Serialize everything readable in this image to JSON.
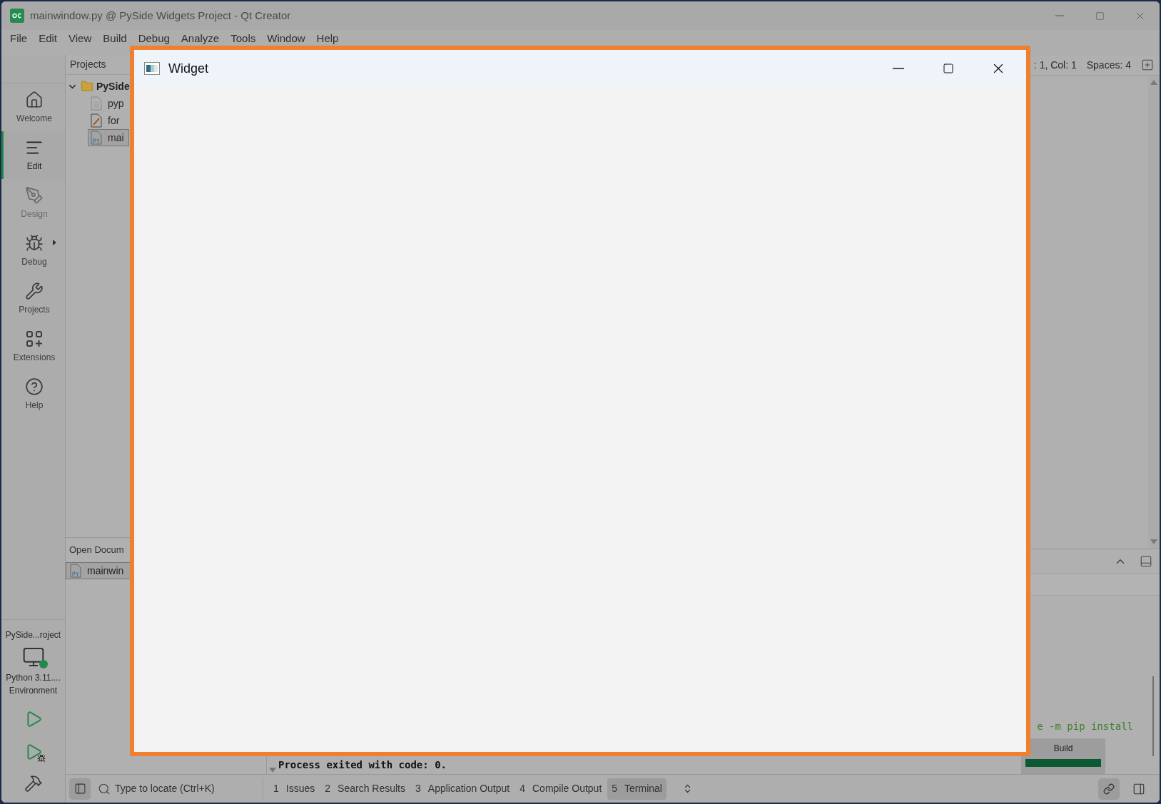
{
  "window": {
    "title": "mainwindow.py @ PySide Widgets Project - Qt Creator"
  },
  "menu": [
    "File",
    "Edit",
    "View",
    "Build",
    "Debug",
    "Analyze",
    "Tools",
    "Window",
    "Help"
  ],
  "modes": [
    {
      "label": "Welcome",
      "selected": false,
      "disabled": false,
      "submenu": false
    },
    {
      "label": "Edit",
      "selected": true,
      "disabled": false,
      "submenu": false
    },
    {
      "label": "Design",
      "selected": false,
      "disabled": true,
      "submenu": false
    },
    {
      "label": "Debug",
      "selected": false,
      "disabled": false,
      "submenu": true
    },
    {
      "label": "Projects",
      "selected": false,
      "disabled": false,
      "submenu": false
    },
    {
      "label": "Extensions",
      "selected": false,
      "disabled": false,
      "submenu": false
    },
    {
      "label": "Help",
      "selected": false,
      "disabled": false,
      "submenu": false
    }
  ],
  "kit": {
    "project": "PySide...roject",
    "name": "Python 3.11....",
    "environment": "Environment"
  },
  "projects": {
    "title": "Projects",
    "tree": [
      {
        "label": "PySide",
        "expanded": true,
        "children": [
          {
            "label": "pyp",
            "kind": "text",
            "selected": false
          },
          {
            "label": "for",
            "kind": "form",
            "selected": false
          },
          {
            "label": "mai",
            "kind": "python",
            "selected": true
          }
        ]
      }
    ]
  },
  "open_documents": {
    "title": "Open Docum",
    "items": [
      {
        "label": "mainwin",
        "selected": true
      }
    ]
  },
  "editor_status": {
    "position": ": 1, Col: 1",
    "indent": "Spaces: 4"
  },
  "output": {
    "lines": [
      "e -m pip install"
    ],
    "status": "Process exited with code: 0."
  },
  "build_progress": {
    "label": "Build",
    "level": 1
  },
  "locator": {
    "placeholder": "Type to locate (Ctrl+K)"
  },
  "output_tabs": [
    {
      "number": "1",
      "label": "Issues",
      "selected": false
    },
    {
      "number": "2",
      "label": "Search Results",
      "selected": false
    },
    {
      "number": "3",
      "label": "Application Output",
      "selected": false
    },
    {
      "number": "4",
      "label": "Compile Output",
      "selected": false
    },
    {
      "number": "5",
      "label": "Terminal",
      "selected": true
    }
  ],
  "dialog": {
    "title": "Widget"
  }
}
